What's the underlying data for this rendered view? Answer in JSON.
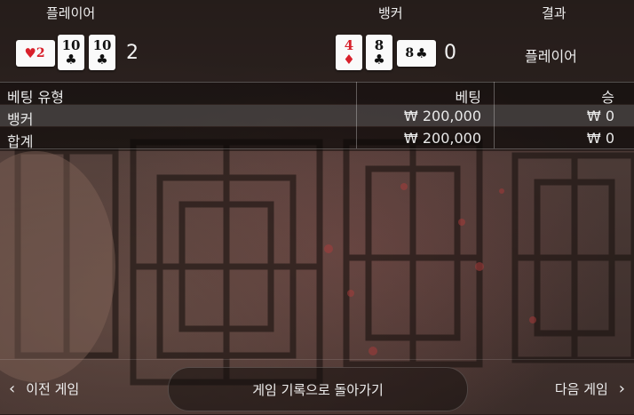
{
  "header": {
    "player_label": "플레이어",
    "banker_label": "뱅커",
    "result_label": "결과"
  },
  "player": {
    "cards": [
      {
        "rank": "2",
        "suit": "♥",
        "color": "red",
        "orientation": "side"
      },
      {
        "rank": "10",
        "suit": "♣",
        "color": "black",
        "orientation": "upright"
      },
      {
        "rank": "10",
        "suit": "♣",
        "color": "black",
        "orientation": "upright"
      }
    ],
    "score": "2"
  },
  "banker": {
    "cards": [
      {
        "rank": "4",
        "suit": "♦",
        "color": "red",
        "orientation": "upright"
      },
      {
        "rank": "8",
        "suit": "♣",
        "color": "black",
        "orientation": "upright"
      },
      {
        "rank": "8",
        "suit": "♣",
        "color": "black",
        "orientation": "side"
      }
    ],
    "score": "0"
  },
  "result": {
    "winner": "플레이어"
  },
  "bets_table": {
    "headers": {
      "type": "베팅 유형",
      "bet": "베팅",
      "win": "승"
    },
    "rows": [
      {
        "type": "뱅커",
        "bet": "₩ 200,000",
        "win": "₩ 0"
      },
      {
        "type": "합계",
        "bet": "₩ 200,000",
        "win": "₩ 0"
      }
    ]
  },
  "navigation": {
    "prev_label": "이전 게임",
    "back_label": "게임 기록으로 돌아가기",
    "next_label": "다음 게임",
    "prev_icon": "chevron-left-icon",
    "next_icon": "chevron-right-icon"
  },
  "colors": {
    "red_suit": "#d8202b",
    "black_suit": "#111111",
    "card_bg": "#fafafa"
  }
}
